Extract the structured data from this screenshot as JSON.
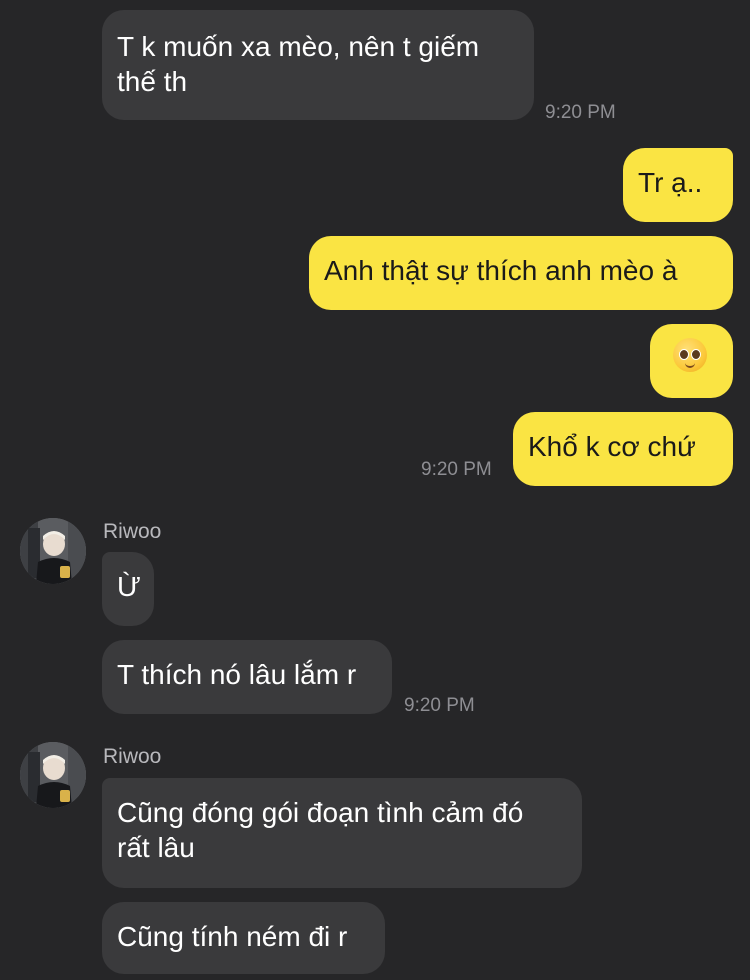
{
  "chat": {
    "messages": [
      {
        "text": "T k muốn xa mèo, nên t giếm\nthế th"
      },
      {
        "text": "Tr ạ.."
      },
      {
        "text": "Anh thật sự thích anh mèo à"
      },
      {
        "text": "Khổ k cơ chứ"
      },
      {
        "text": "Ừ"
      },
      {
        "text": "T thích nó lâu lắm r"
      },
      {
        "text": "Cũng đóng gói đoạn tình cảm đó\nrất lâu"
      },
      {
        "text": "Cũng tính ném đi r"
      }
    ],
    "timestamps": [
      "9:20 PM",
      "9:20 PM",
      "9:20 PM"
    ],
    "senders": [
      "Riwoo",
      "Riwoo"
    ],
    "emoji": "pleading-face-icon"
  },
  "colors": {
    "background": "#262628",
    "incoming_bubble": "#3a3a3c",
    "outgoing_bubble": "#fae443",
    "timestamp": "#8e8e93"
  }
}
